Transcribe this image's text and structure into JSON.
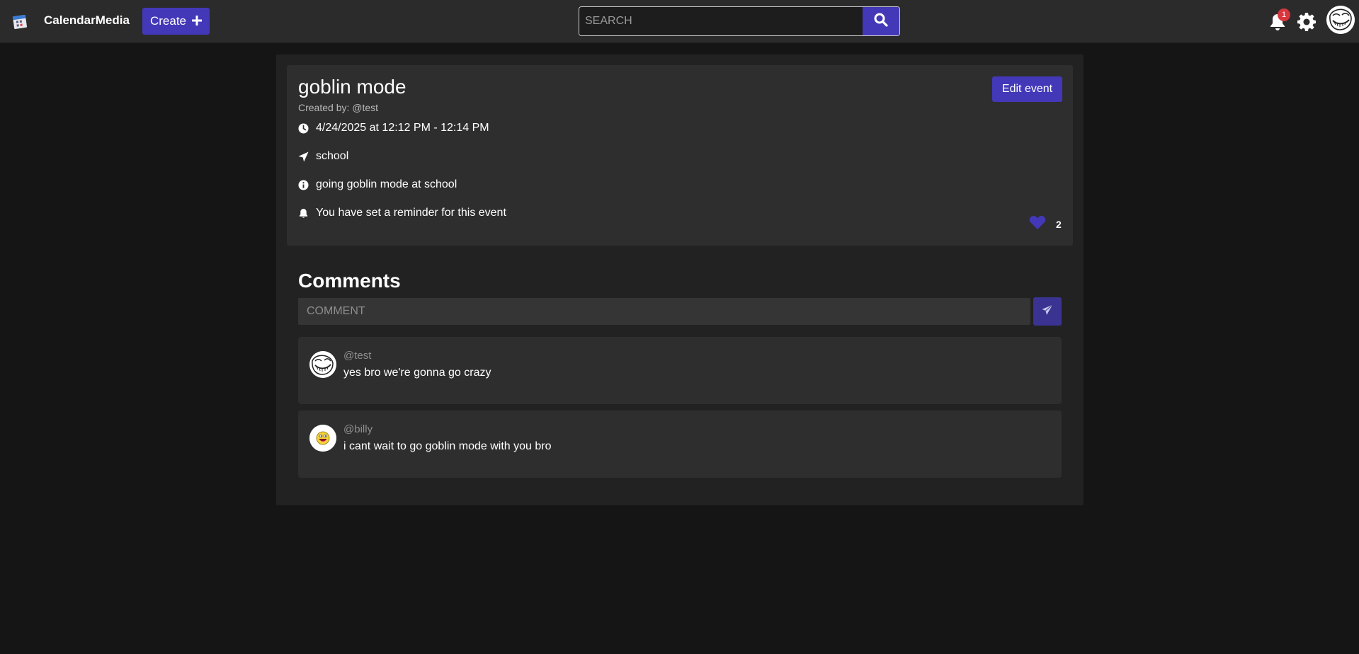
{
  "header": {
    "brand": "CalendarMedia",
    "create_label": "Create",
    "search_placeholder": "SEARCH",
    "notification_count": "1",
    "icons": {
      "logo": "calendar-logo-icon",
      "search": "search-icon",
      "bell": "bell-icon",
      "settings": "gear-icon",
      "avatar": "trollface-avatar"
    }
  },
  "event": {
    "title": "goblin mode",
    "created_by": "Created by: @test",
    "edit_label": "Edit event",
    "datetime": "4/24/2025 at 12:12 PM - 12:14 PM",
    "location": "school",
    "description": "going goblin mode at school",
    "reminder": "You have set a reminder for this event",
    "likes": "2"
  },
  "comments": {
    "heading": "Comments",
    "input_placeholder": "COMMENT",
    "items": [
      {
        "user": "@test",
        "text": "yes bro we're gonna go crazy",
        "avatar": "trollface-avatar"
      },
      {
        "user": "@billy",
        "text": "i cant wait to go goblin mode with you bro",
        "avatar": "awesome-face-avatar"
      }
    ]
  },
  "colors": {
    "accent": "#4338b8",
    "background": "#151515",
    "topbar": "#2b2b2b",
    "panel": "#222222",
    "card": "#2e2e2e",
    "badge": "#d9363e"
  }
}
